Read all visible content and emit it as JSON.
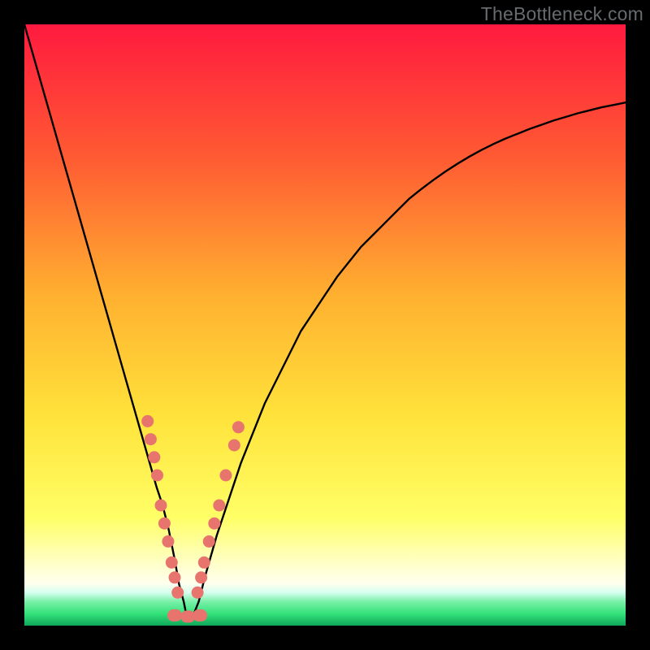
{
  "watermark": "TheBottleneck.com",
  "colors": {
    "background": "#000000",
    "curve": "#000000",
    "markers_fill": "#e8746e",
    "markers_stroke": "#d85f58",
    "gradient": {
      "top": "#ff1a3f",
      "mid1": "#ff6c2c",
      "mid2": "#ffd23a",
      "mid3": "#ffff66",
      "band_light": "#ffffee",
      "green": "#34e27a",
      "green_deep": "#0fa85a"
    }
  },
  "chart_data": {
    "type": "line",
    "title": "",
    "xlabel": "",
    "ylabel": "",
    "xlim": [
      0,
      100
    ],
    "ylim": [
      0,
      100
    ],
    "x": [
      0,
      2,
      4,
      6,
      8,
      10,
      12,
      14,
      16,
      18,
      20,
      22,
      23,
      24,
      25,
      25.7,
      26.5,
      27,
      28,
      29,
      30,
      32,
      34,
      36,
      38,
      40,
      42,
      44,
      46,
      48,
      50,
      52,
      54,
      56,
      58,
      60,
      62,
      64,
      66,
      68,
      70,
      72,
      74,
      76,
      78,
      80,
      82,
      84,
      86,
      88,
      90,
      92,
      94,
      96,
      98,
      100
    ],
    "y": [
      100,
      93,
      86,
      79,
      72,
      65,
      58,
      51,
      44,
      37,
      30,
      23,
      20,
      16,
      11,
      7,
      4,
      1.5,
      1.5,
      4,
      8,
      15,
      21,
      27,
      32,
      37,
      41,
      45,
      49,
      52,
      55,
      58,
      60.5,
      63,
      65,
      67,
      69,
      71,
      72.6,
      74.1,
      75.5,
      76.8,
      78,
      79.1,
      80.1,
      81,
      81.8,
      82.6,
      83.3,
      84,
      84.6,
      85.2,
      85.7,
      86.2,
      86.6,
      87
    ],
    "markers_left": [
      {
        "x": 20.5,
        "y": 34
      },
      {
        "x": 21.0,
        "y": 31
      },
      {
        "x": 21.6,
        "y": 28
      },
      {
        "x": 22.1,
        "y": 25
      },
      {
        "x": 22.7,
        "y": 20
      },
      {
        "x": 23.3,
        "y": 17
      },
      {
        "x": 23.9,
        "y": 14
      },
      {
        "x": 24.5,
        "y": 10.5
      },
      {
        "x": 25.0,
        "y": 8
      },
      {
        "x": 25.5,
        "y": 5.5
      }
    ],
    "markers_right": [
      {
        "x": 28.8,
        "y": 5.5
      },
      {
        "x": 29.4,
        "y": 8
      },
      {
        "x": 29.9,
        "y": 10.5
      },
      {
        "x": 30.7,
        "y": 14
      },
      {
        "x": 31.6,
        "y": 17
      },
      {
        "x": 32.4,
        "y": 20
      },
      {
        "x": 33.5,
        "y": 25
      },
      {
        "x": 34.9,
        "y": 30
      },
      {
        "x": 35.6,
        "y": 33
      }
    ],
    "markers_bottom": [
      {
        "x": 25.0,
        "y": 1.7,
        "w": 2.2
      },
      {
        "x": 27.2,
        "y": 1.5,
        "w": 2.1
      },
      {
        "x": 29.2,
        "y": 1.7,
        "w": 2.0
      }
    ],
    "comment": "x and y are in 0–100 space; y=0 at bottom (green), y=100 at top (red). Curve is a V-shaped bottleneck curve with minimum near x≈27."
  }
}
